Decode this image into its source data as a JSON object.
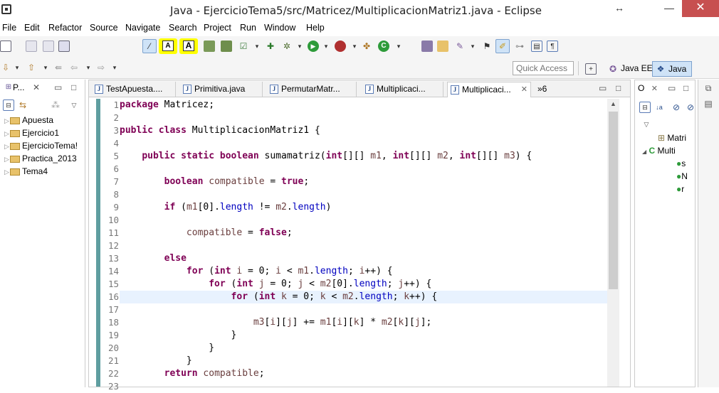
{
  "window": {
    "title": "Java - EjercicioTema5/src/Matricez/MultiplicacionMatriz1.java - Eclipse",
    "restore_icon": "↔",
    "minimize_icon": "—",
    "close_icon": "✕"
  },
  "menu": [
    "File",
    "Edit",
    "Refactor",
    "Source",
    "Navigate",
    "Search",
    "Project",
    "Run",
    "Window",
    "Help"
  ],
  "toolbar": {
    "quick_access_placeholder": "Quick Access",
    "perspective_java_ee": "Java EE",
    "perspective_java": "Java",
    "font_smaller_label": "A",
    "font_bigger_label": "A"
  },
  "package_explorer": {
    "tab_label": "P...",
    "tab_close": "✕",
    "items": [
      "Apuesta",
      "Ejercicio1",
      "EjercicioTema!",
      "Practica_2013",
      "Tema4"
    ]
  },
  "editor": {
    "tabs": [
      {
        "label": "TestApuesta....",
        "active": false
      },
      {
        "label": "Primitiva.java",
        "active": false
      },
      {
        "label": "PermutarMatr...",
        "active": false
      },
      {
        "label": "Multiplicaci...",
        "active": false
      },
      {
        "label": "Multiplicaci...",
        "active": true
      }
    ],
    "tab_overflow": "»6",
    "line_numbers": [
      "1",
      "2",
      "3",
      "4",
      "5",
      "6",
      "7",
      "8",
      "9",
      "10",
      "11",
      "12",
      "13",
      "14",
      "15",
      "16",
      "17",
      "18",
      "19",
      "20",
      "21",
      "22",
      "23"
    ],
    "current_line": 16
  },
  "outline": {
    "tab_label": "O",
    "items": [
      "Matri",
      "Multi",
      "s",
      "N",
      "r"
    ]
  },
  "colors": {
    "keyword": "#7f0055",
    "field": "#0000c0",
    "variable": "#6a3e3e",
    "highlight": "#ffff00",
    "current_line": "#e8f2fe"
  }
}
